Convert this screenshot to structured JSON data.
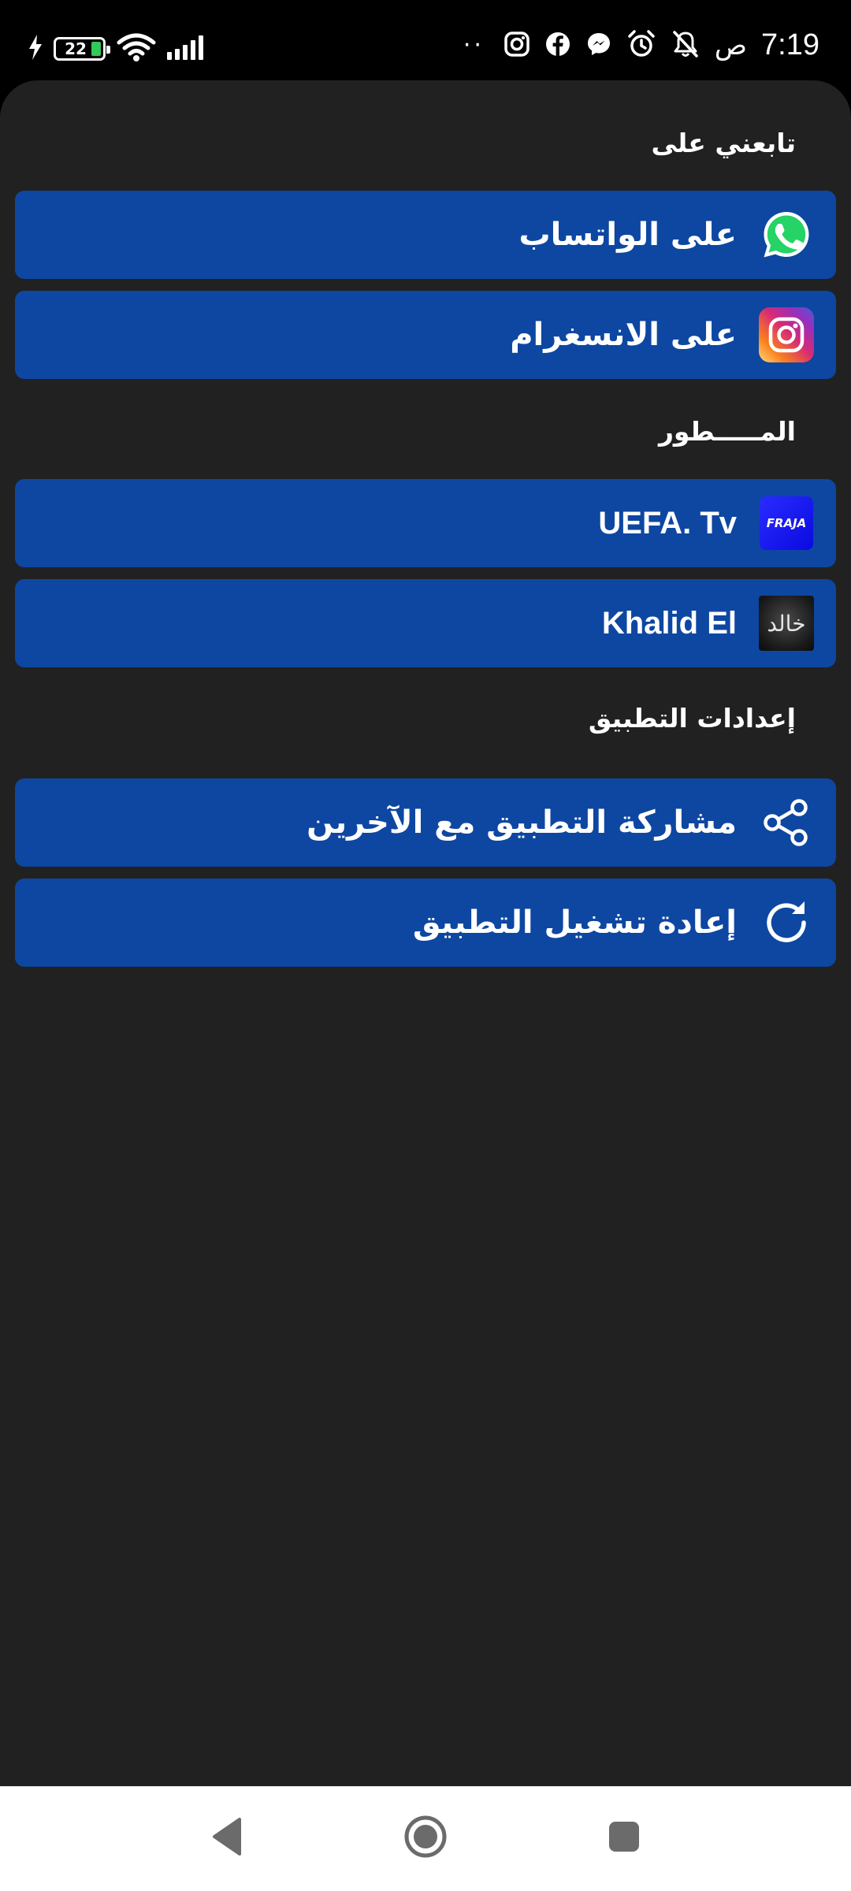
{
  "status_bar": {
    "time": "7:19",
    "am_pm": "ص",
    "battery_level": "22",
    "battery_fraction": 0.22,
    "more_dots": "··",
    "icons": [
      "charging-bolt-icon",
      "battery-icon",
      "wifi-icon",
      "signal-icon",
      "instagram-notification-icon",
      "facebook-notification-icon",
      "messenger-notification-icon",
      "alarm-icon",
      "notifications-off-icon"
    ]
  },
  "sections": {
    "follow": {
      "title": "تابعني على",
      "items": [
        {
          "label": "على الواتساب",
          "icon": "whatsapp-icon"
        },
        {
          "label": "على الانسغرام",
          "icon": "instagram-icon"
        }
      ]
    },
    "developer": {
      "title": "المـــــطور",
      "items": [
        {
          "label": "UEFA. Tv",
          "icon": "fraja-logo-icon",
          "icon_text": "FRAJA"
        },
        {
          "label": "Khalid El",
          "icon": "khalid-avatar-icon",
          "icon_text": "خالد"
        }
      ]
    },
    "settings": {
      "title": "إعدادات التطبيق",
      "items": [
        {
          "label": "مشاركة التطبيق مع الآخرين",
          "icon": "share-icon"
        },
        {
          "label": "إعادة تشغيل التطبيق",
          "icon": "restart-icon"
        }
      ]
    }
  },
  "nav_bar": {
    "buttons": [
      "back-icon",
      "home-icon",
      "recents-icon"
    ]
  },
  "colors": {
    "background": "#000000",
    "sheet": "#212121",
    "row": "#0d47a1",
    "text": "#ffffff",
    "nav_bar": "#ffffff",
    "nav_icons": "#6b6b6b",
    "whatsapp": "#25d366",
    "battery_fill": "#34c759"
  }
}
